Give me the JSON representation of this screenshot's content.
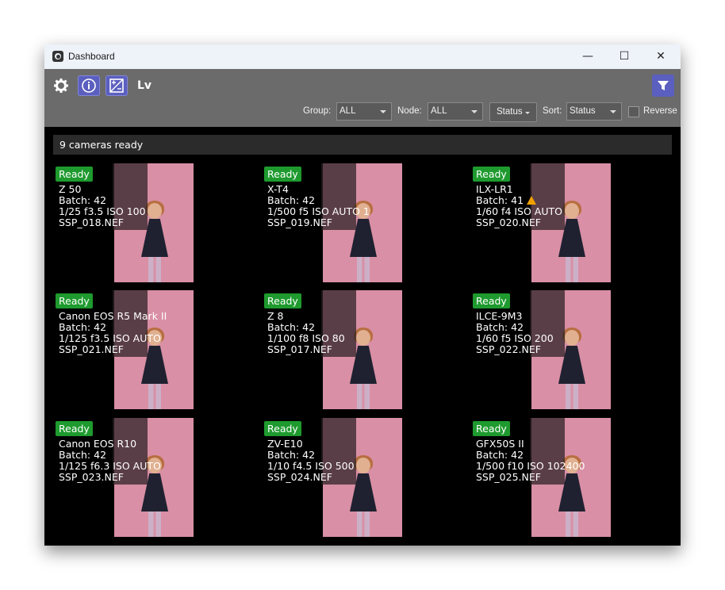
{
  "window": {
    "title": "Dashboard",
    "controls": [
      "—",
      "☐",
      "✕"
    ]
  },
  "toolbar": {
    "icons": [
      "gear-icon",
      "info-icon",
      "exposure-icon",
      "lv-icon"
    ],
    "lv_label": "Lv",
    "group_label": "Group:",
    "group_value": "ALL",
    "node_label": "Node:",
    "node_value": "ALL",
    "status_button_label": "Status",
    "sort_label": "Sort:",
    "sort_value": "Status",
    "reverse_label": "Reverse",
    "reverse_checked": false
  },
  "status_summary": "9 cameras ready",
  "colors": {
    "accent": "#5b5fbf",
    "ready_badge": "#1e9a2e",
    "warning": "#f0a000",
    "backdrop": "#d98fa5"
  },
  "cameras": [
    {
      "status": "Ready",
      "model": "Z 50",
      "batch": "Batch: 42",
      "exposure": "1/25 f3.5 ISO 100",
      "file": "SSP_018.NEF"
    },
    {
      "status": "Ready",
      "model": "X-T4",
      "batch": "Batch: 42",
      "exposure": "1/500 f5 ISO AUTO 1",
      "file": "SSP_019.NEF"
    },
    {
      "status": "Ready",
      "model": "ILX-LR1",
      "batch": "Batch: 41",
      "exposure": "1/60 f4 ISO AUTO",
      "file": "SSP_020.NEF",
      "warning": true
    },
    {
      "status": "Ready",
      "model": "Canon EOS R5 Mark II",
      "batch": "Batch: 42",
      "exposure": "1/125 f3.5 ISO AUTO",
      "file": "SSP_021.NEF"
    },
    {
      "status": "Ready",
      "model": "Z 8",
      "batch": "Batch: 42",
      "exposure": "1/100 f8 ISO 80",
      "file": "SSP_017.NEF"
    },
    {
      "status": "Ready",
      "model": "ILCE-9M3",
      "batch": "Batch: 42",
      "exposure": "1/60 f5 ISO 200",
      "file": "SSP_022.NEF"
    },
    {
      "status": "Ready",
      "model": "Canon EOS R10",
      "batch": "Batch: 42",
      "exposure": "1/125 f6.3 ISO AUTO",
      "file": "SSP_023.NEF"
    },
    {
      "status": "Ready",
      "model": "ZV-E10",
      "batch": "Batch: 42",
      "exposure": "1/10 f4.5 ISO 500",
      "file": "SSP_024.NEF"
    },
    {
      "status": "Ready",
      "model": "GFX50S II",
      "batch": "Batch: 42",
      "exposure": "1/500 f10 ISO 102400",
      "file": "SSP_025.NEF"
    }
  ]
}
